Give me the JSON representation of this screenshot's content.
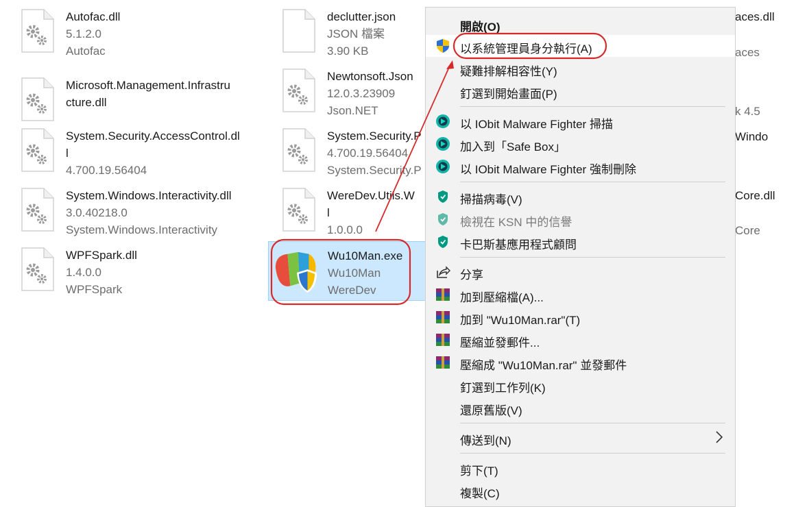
{
  "files": [
    {
      "name": "Autofac.dll",
      "line2": "5.1.2.0",
      "line3": "Autofac",
      "icon": "dll-file-icon"
    },
    {
      "name": "Microsoft.Management.Infrastru\ncture.dll",
      "line2": "",
      "line3": "",
      "icon": "dll-file-icon"
    },
    {
      "name": "System.Security.AccessControl.dl\nl",
      "line2": "",
      "line3": "4.700.19.56404",
      "icon": "dll-file-icon"
    },
    {
      "name": "System.Windows.Interactivity.dll",
      "line2": "3.0.40218.0",
      "line3": "System.Windows.Interactivity",
      "icon": "dll-file-icon"
    },
    {
      "name": "WPFSpark.dll",
      "line2": "1.4.0.0",
      "line3": "WPFSpark",
      "icon": "dll-file-icon"
    },
    {
      "name": "declutter.json",
      "line2": "JSON 檔案",
      "line3": "3.90 KB",
      "icon": "json-file-icon"
    },
    {
      "name": "Newtonsoft.Json",
      "line2": "12.0.3.23909",
      "line3": "Json.NET",
      "icon": "dll-file-icon"
    },
    {
      "name": "System.Security.P",
      "line2": "4.700.19.56404",
      "line3": "System.Security.P",
      "icon": "dll-file-icon"
    },
    {
      "name": "WereDev.Utils.W\nl",
      "line2": "",
      "line3": "1.0.0.0",
      "icon": "dll-file-icon"
    },
    {
      "name": "Wu10Man.exe",
      "line2": "Wu10Man",
      "line3": "WereDev",
      "icon": "wu10man-app-icon"
    }
  ],
  "partial_right": [
    "aces.dll",
    "aces",
    "k 4.5",
    "Windo",
    "Core.dll",
    "Core"
  ],
  "context_menu": {
    "items": [
      {
        "label": "開啟(O)",
        "icon": "",
        "bold": true
      },
      {
        "label": "以系統管理員身分執行(A)",
        "icon": "uac-shield-icon"
      },
      {
        "label": "疑難排解相容性(Y)",
        "icon": ""
      },
      {
        "label": "釘選到開始畫面(P)",
        "icon": ""
      },
      {
        "label": "以 IObit Malware Fighter 掃描",
        "icon": "iobit-shield-icon"
      },
      {
        "label": "加入到「Safe Box」",
        "icon": "iobit-shield-icon"
      },
      {
        "label": "以 IObit Malware Fighter 強制刪除",
        "icon": "iobit-shield-icon"
      },
      {
        "label": "掃描病毒(V)",
        "icon": "kaspersky-shield-icon"
      },
      {
        "label": "檢視在 KSN 中的信譽",
        "icon": "kaspersky-shield-icon",
        "disabled": true
      },
      {
        "label": "卡巴斯基應用程式顧問",
        "icon": "kaspersky-shield-icon"
      },
      {
        "label": "分享",
        "icon": "share-icon"
      },
      {
        "label": "加到壓縮檔(A)...",
        "icon": "winrar-icon"
      },
      {
        "label": "加到 \"Wu10Man.rar\"(T)",
        "icon": "winrar-icon"
      },
      {
        "label": "壓縮並發郵件...",
        "icon": "winrar-icon"
      },
      {
        "label": "壓縮成 \"Wu10Man.rar\" 並發郵件",
        "icon": "winrar-icon"
      },
      {
        "label": "釘選到工作列(K)",
        "icon": ""
      },
      {
        "label": "還原舊版(V)",
        "icon": ""
      },
      {
        "label": "傳送到(N)",
        "icon": "",
        "submenu": true
      },
      {
        "label": "剪下(T)",
        "icon": ""
      },
      {
        "label": "複製(C)",
        "icon": ""
      }
    ]
  },
  "colors": {
    "annotation": "#d62a2a",
    "selection": "#cce8ff",
    "iobit": "#13b3a8",
    "kaspersky": "#009a82"
  }
}
